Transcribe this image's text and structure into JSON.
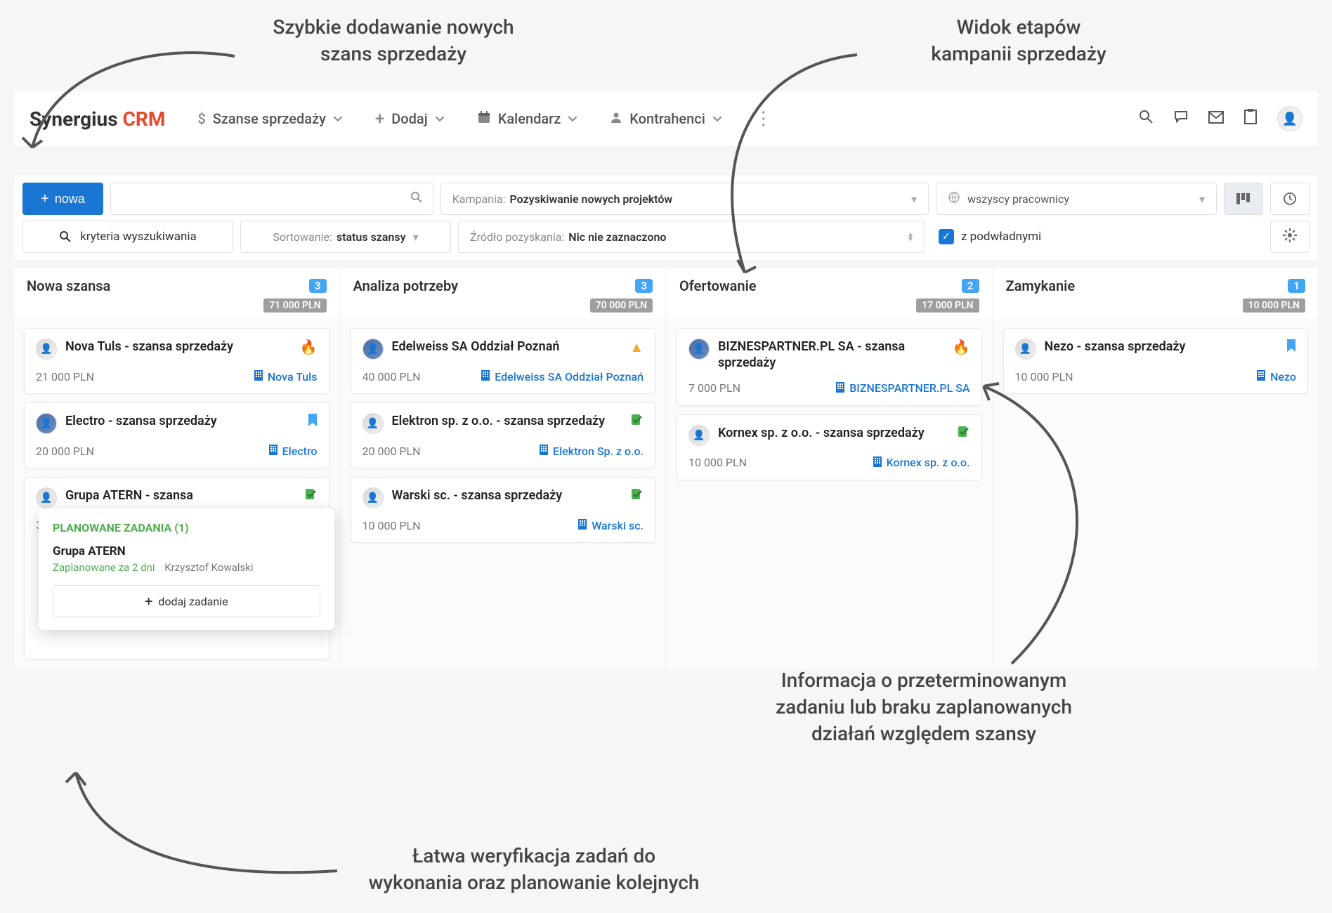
{
  "annotations": {
    "top_left": "Szybkie dodawanie nowych\nszans sprzedaży",
    "top_right": "Widok etapów\nkampanii sprzedaży",
    "mid_right": "Informacja o przeterminowanym\nzadaniu lub braku zaplanowanych\ndziałań względem szansy",
    "bottom": "Łatwa weryfikacja zadań do\nwykonania oraz planowanie kolejnych"
  },
  "logo": {
    "brand": "Synergius ",
    "suffix": "CRM"
  },
  "nav": {
    "sales": "Szanse sprzedaży",
    "add": "Dodaj",
    "calendar": "Kalendarz",
    "contractors": "Kontrahenci"
  },
  "filter": {
    "new_btn": "nowa",
    "criteria": "kryteria wyszukiwania",
    "sort_label": "Sortowanie:",
    "sort_value": "status szansy",
    "campaign_label": "Kampania:",
    "campaign_value": "Pozyskiwanie nowych projektów",
    "source_label": "Źródło pozyskania:",
    "source_value": "Nic nie zaznaczono",
    "employees": "wszyscy pracownicy",
    "with_sub": "z podwładnymi"
  },
  "columns": [
    {
      "title": "Nowa szansa",
      "count": "3",
      "sum": "71 000 PLN",
      "cards": [
        {
          "title": "Nova Tuls - szansa sprzedaży",
          "amount": "21 000 PLN",
          "company": "Nova Tuls",
          "status": "fire",
          "avatar": "plain"
        },
        {
          "title": "Electro - szansa sprzedaży",
          "amount": "20 000 PLN",
          "company": "Electro",
          "status": "bookmark",
          "avatar": "blue"
        },
        {
          "title": "Grupa ATERN - szansa",
          "amount": "3",
          "company": "",
          "status": "ok",
          "avatar": "plain",
          "popover": {
            "head": "PLANOWANE ZADANIA (1)",
            "task_title": "Grupa ATERN",
            "due": "Zaplanowane za 2 dni",
            "assignee": "Krzysztof Kowalski",
            "add_btn": "dodaj zadanie"
          }
        }
      ]
    },
    {
      "title": "Analiza potrzeby",
      "count": "3",
      "sum": "70 000 PLN",
      "cards": [
        {
          "title": "Edelweiss SA Oddział Poznań",
          "amount": "40 000 PLN",
          "company": "Edelweiss SA Oddział Poznań",
          "status": "warn",
          "avatar": "blue"
        },
        {
          "title": "Elektron sp. z o.o. - szansa sprzedaży",
          "amount": "20 000 PLN",
          "company": "Elektron Sp. z o.o.",
          "status": "ok",
          "avatar": "plain"
        },
        {
          "title": "Warski sc. - szansa sprzedaży",
          "amount": "10 000 PLN",
          "company": "Warski sc.",
          "status": "ok",
          "avatar": "plain"
        }
      ]
    },
    {
      "title": "Ofertowanie",
      "count": "2",
      "sum": "17 000 PLN",
      "cards": [
        {
          "title": "BIZNESPARTNER.PL SA - szansa sprzedaży",
          "amount": "7 000 PLN",
          "company": "BIZNESPARTNER.PL SA",
          "status": "fire",
          "avatar": "blue"
        },
        {
          "title": "Kornex sp. z o.o. - szansa sprzedaży",
          "amount": "10 000 PLN",
          "company": "Kornex sp. z o.o.",
          "status": "ok",
          "avatar": "plain"
        }
      ]
    },
    {
      "title": "Zamykanie",
      "count": "1",
      "sum": "10 000 PLN",
      "cards": [
        {
          "title": "Nezo - szansa sprzedaży",
          "amount": "10 000 PLN",
          "company": "Nezo",
          "status": "bookmark",
          "avatar": "plain"
        }
      ]
    }
  ]
}
